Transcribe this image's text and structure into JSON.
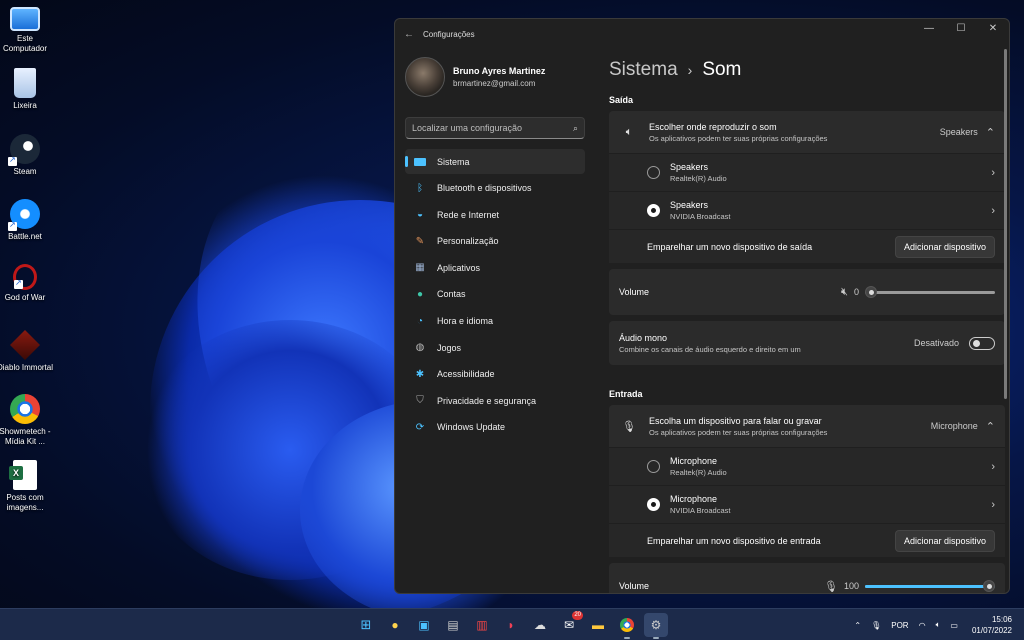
{
  "desktop": {
    "icons": [
      {
        "label": "Este Computador",
        "icon": "monitor-icon"
      },
      {
        "label": "Lixeira",
        "icon": "recycle-bin-icon"
      },
      {
        "label": "Steam",
        "icon": "steam-icon"
      },
      {
        "label": "Battle.net",
        "icon": "battlenet-icon"
      },
      {
        "label": "God of War",
        "icon": "god-of-war-icon"
      },
      {
        "label": "Diablo Immortal",
        "icon": "diablo-icon"
      },
      {
        "label": "Showmetech - Mídia Kit ...",
        "icon": "chrome-icon"
      },
      {
        "label": "Posts com imagens...",
        "icon": "excel-icon"
      }
    ]
  },
  "window": {
    "title": "Configurações",
    "controls": {
      "minimize": "—",
      "maximize": "☐",
      "close": "✕"
    }
  },
  "profile": {
    "name": "Bruno Ayres Martinez",
    "email": "brmartinez@gmail.com"
  },
  "search": {
    "placeholder": "Localizar uma configuração"
  },
  "nav": [
    {
      "label": "Sistema",
      "icon": "system-icon",
      "active": true
    },
    {
      "label": "Bluetooth e dispositivos",
      "icon": "bluetooth-icon"
    },
    {
      "label": "Rede e Internet",
      "icon": "wifi-icon"
    },
    {
      "label": "Personalização",
      "icon": "brush-icon"
    },
    {
      "label": "Aplicativos",
      "icon": "apps-icon"
    },
    {
      "label": "Contas",
      "icon": "account-icon"
    },
    {
      "label": "Hora e idioma",
      "icon": "globe-clock-icon"
    },
    {
      "label": "Jogos",
      "icon": "gamepad-icon"
    },
    {
      "label": "Acessibilidade",
      "icon": "accessibility-icon"
    },
    {
      "label": "Privacidade e segurança",
      "icon": "shield-icon"
    },
    {
      "label": "Windows Update",
      "icon": "update-icon"
    }
  ],
  "breadcrumb": {
    "parent": "Sistema",
    "separator": "›",
    "current": "Som"
  },
  "output": {
    "heading": "Saída",
    "choose": {
      "title": "Escolher onde reproduzir o som",
      "subtitle": "Os aplicativos podem ter suas próprias configurações",
      "value": "Speakers"
    },
    "devices": [
      {
        "name": "Speakers",
        "driver": "Realtek(R) Audio",
        "selected": false
      },
      {
        "name": "Speakers",
        "driver": "NVIDIA Broadcast",
        "selected": true
      }
    ],
    "pair": {
      "label": "Emparelhar um novo dispositivo de saída",
      "button": "Adicionar dispositivo"
    },
    "volume": {
      "label": "Volume",
      "value": "0",
      "level": 0
    },
    "mono": {
      "title": "Áudio mono",
      "subtitle": "Combine os canais de áudio esquerdo e direito em um",
      "state": "Desativado"
    }
  },
  "input": {
    "heading": "Entrada",
    "choose": {
      "title": "Escolha um dispositivo para falar ou gravar",
      "subtitle": "Os aplicativos podem ter suas próprias configurações",
      "value": "Microphone"
    },
    "devices": [
      {
        "name": "Microphone",
        "driver": "Realtek(R) Audio",
        "selected": false
      },
      {
        "name": "Microphone",
        "driver": "NVIDIA Broadcast",
        "selected": true
      }
    ],
    "pair": {
      "label": "Emparelhar um novo dispositivo de entrada",
      "button": "Adicionar dispositivo"
    },
    "volume": {
      "label": "Volume",
      "value": "100",
      "level": 1
    }
  },
  "taskbar": {
    "badge": "20",
    "lang": "POR",
    "time": "15:06",
    "date": "01/07/2022"
  },
  "colors": {
    "accent": "#4cc2ff",
    "window_bg": "#202020",
    "card_bg": "#2b2b2b"
  }
}
